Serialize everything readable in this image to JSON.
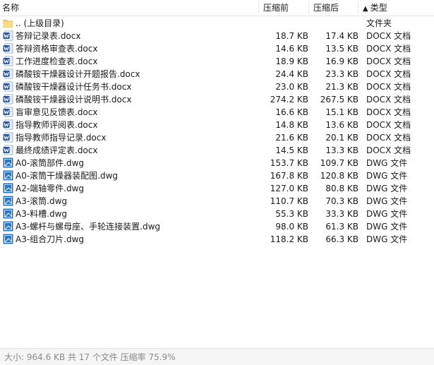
{
  "header": {
    "name_label": "名称",
    "size_label": "压缩前",
    "packed_label": "压缩后",
    "type_sort_arrow": "▲",
    "type_label": "类型"
  },
  "files": [
    {
      "icon": "folder-up-icon",
      "name": ".. (上级目录)",
      "size": "",
      "packed": "",
      "type": "文件夹"
    },
    {
      "icon": "word-doc-icon",
      "name": "答辩记录表.docx",
      "size": "18.7 KB",
      "packed": "17.4 KB",
      "type": "DOCX 文档"
    },
    {
      "icon": "word-doc-icon",
      "name": "答辩资格审查表.docx",
      "size": "14.6 KB",
      "packed": "13.5 KB",
      "type": "DOCX 文档"
    },
    {
      "icon": "word-doc-icon",
      "name": "工作进度检查表.docx",
      "size": "18.9 KB",
      "packed": "16.9 KB",
      "type": "DOCX 文档"
    },
    {
      "icon": "word-doc-icon",
      "name": "磷酸铵干燥器设计开题报告.docx",
      "size": "24.4 KB",
      "packed": "23.3 KB",
      "type": "DOCX 文档"
    },
    {
      "icon": "word-doc-icon",
      "name": "磷酸铵干燥器设计任务书.docx",
      "size": "23.0 KB",
      "packed": "21.3 KB",
      "type": "DOCX 文档"
    },
    {
      "icon": "word-doc-icon",
      "name": "磷酸铵干燥器设计说明书.docx",
      "size": "274.2 KB",
      "packed": "267.5 KB",
      "type": "DOCX 文档"
    },
    {
      "icon": "word-doc-icon",
      "name": "盲审意见反馈表.docx",
      "size": "16.6 KB",
      "packed": "15.1 KB",
      "type": "DOCX 文档"
    },
    {
      "icon": "word-doc-icon",
      "name": "指导教师评阅表.docx",
      "size": "14.8 KB",
      "packed": "13.6 KB",
      "type": "DOCX 文档"
    },
    {
      "icon": "word-doc-icon",
      "name": "指导教师指导记录.docx",
      "size": "21.6 KB",
      "packed": "20.1 KB",
      "type": "DOCX 文档"
    },
    {
      "icon": "word-doc-icon",
      "name": "最终成绩评定表.docx",
      "size": "14.5 KB",
      "packed": "13.3 KB",
      "type": "DOCX 文档"
    },
    {
      "icon": "dwg-file-icon",
      "name": "A0-滚筒部件.dwg",
      "size": "153.7 KB",
      "packed": "109.7 KB",
      "type": "DWG 文件"
    },
    {
      "icon": "dwg-file-icon",
      "name": "A0-滚筒干燥器装配图.dwg",
      "size": "167.8 KB",
      "packed": "120.8 KB",
      "type": "DWG 文件"
    },
    {
      "icon": "dwg-file-icon",
      "name": "A2-端轴零件.dwg",
      "size": "127.0 KB",
      "packed": "80.8 KB",
      "type": "DWG 文件"
    },
    {
      "icon": "dwg-file-icon",
      "name": "A3-滚筒.dwg",
      "size": "110.7 KB",
      "packed": "70.3 KB",
      "type": "DWG 文件"
    },
    {
      "icon": "dwg-file-icon",
      "name": "A3-料槽.dwg",
      "size": "55.3 KB",
      "packed": "33.3 KB",
      "type": "DWG 文件"
    },
    {
      "icon": "dwg-file-icon",
      "name": "A3-螺杆与螺母座、手轮连接装置.dwg",
      "size": "98.0 KB",
      "packed": "61.3 KB",
      "type": "DWG 文件"
    },
    {
      "icon": "dwg-file-icon",
      "name": "A3-组合刀片.dwg",
      "size": "118.2 KB",
      "packed": "66.3 KB",
      "type": "DWG 文件"
    }
  ],
  "status": {
    "text": "大小: 964.6 KB 共 17 个文件 压缩率 75.9%"
  },
  "colors": {
    "folder": "#F3CF6E",
    "word_blue": "#2B5797",
    "dwg_blue": "#2B78C8",
    "status_text": "#8A8A8A"
  }
}
